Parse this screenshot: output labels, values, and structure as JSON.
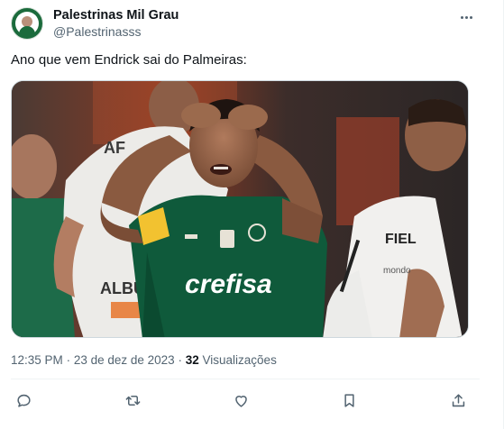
{
  "user": {
    "name": "Palestrinas Mil Grau",
    "handle": "@Palestrinasss"
  },
  "tweet": {
    "text": "Ano que vem Endrick sai do Palmeiras:"
  },
  "image": {
    "sponsor_text": "crefisa",
    "player_shirt_text": "AF",
    "opponent_sponsor": "FIEL",
    "opponent_sleeve_text": "ALBUINA",
    "opponent_small_text": "mondo"
  },
  "meta": {
    "time": "12:35 PM",
    "separator": "·",
    "date": "23 de dez de 2023",
    "views_count": "32",
    "views_label": "Visualizações"
  },
  "colors": {
    "palmeiras_green": "#0f5a3b",
    "text_primary": "#0f1419",
    "text_secondary": "#536471"
  },
  "icons": [
    "reply-icon",
    "retweet-icon",
    "like-icon",
    "bookmark-icon",
    "share-icon",
    "more-icon"
  ]
}
